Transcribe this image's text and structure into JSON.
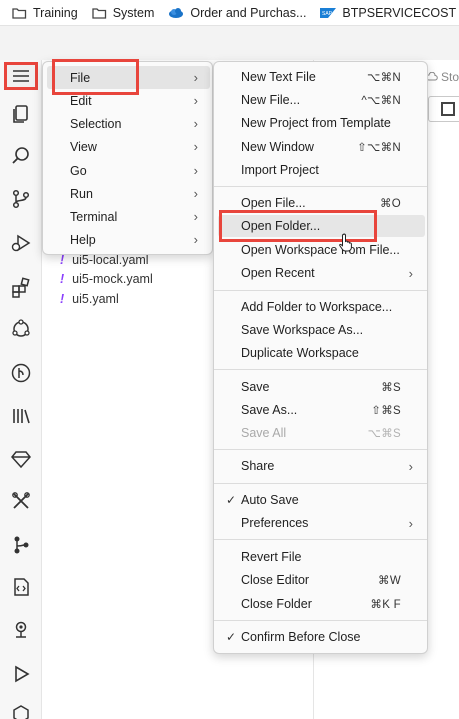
{
  "bookmarks": [
    {
      "label": "Training",
      "icon": "folder-icon"
    },
    {
      "label": "System",
      "icon": "folder-icon"
    },
    {
      "label": "Order and Purchas...",
      "icon": "cloud-icon"
    },
    {
      "label": "BTPSERVICECOST",
      "icon": "sap-icon"
    }
  ],
  "editor": {
    "tab_label": "Sto"
  },
  "explorer": {
    "files": [
      "ui5-local.yaml",
      "ui5-mock.yaml",
      "ui5.yaml"
    ],
    "file_marker": "!"
  },
  "main_menu": {
    "items": [
      {
        "label": "File"
      },
      {
        "label": "Edit"
      },
      {
        "label": "Selection"
      },
      {
        "label": "View"
      },
      {
        "label": "Go"
      },
      {
        "label": "Run"
      },
      {
        "label": "Terminal"
      },
      {
        "label": "Help"
      }
    ],
    "arrow": "›"
  },
  "file_menu": {
    "groups": [
      [
        {
          "label": "New Text File",
          "shortcut": "⌥⌘N"
        },
        {
          "label": "New File...",
          "shortcut": "^⌥⌘N"
        },
        {
          "label": "New Project from Template",
          "shortcut": ""
        },
        {
          "label": "New Window",
          "shortcut": "⇧⌥⌘N"
        },
        {
          "label": "Import Project",
          "shortcut": ""
        }
      ],
      [
        {
          "label": "Open File...",
          "shortcut": "⌘O"
        },
        {
          "label": "Open Folder...",
          "shortcut": ""
        },
        {
          "label": "Open Workspace from File...",
          "shortcut": ""
        },
        {
          "label": "Open Recent",
          "shortcut": "",
          "submenu": true
        }
      ],
      [
        {
          "label": "Add Folder to Workspace...",
          "shortcut": ""
        },
        {
          "label": "Save Workspace As...",
          "shortcut": ""
        },
        {
          "label": "Duplicate Workspace",
          "shortcut": ""
        }
      ],
      [
        {
          "label": "Save",
          "shortcut": "⌘S"
        },
        {
          "label": "Save As...",
          "shortcut": "⇧⌘S"
        },
        {
          "label": "Save All",
          "shortcut": "⌥⌘S",
          "disabled": true
        }
      ],
      [
        {
          "label": "Share",
          "shortcut": "",
          "submenu": true
        }
      ],
      [
        {
          "label": "Auto Save",
          "shortcut": "",
          "checked": true
        },
        {
          "label": "Preferences",
          "shortcut": "",
          "submenu": true
        }
      ],
      [
        {
          "label": "Revert File",
          "shortcut": ""
        },
        {
          "label": "Close Editor",
          "shortcut": "⌘W"
        },
        {
          "label": "Close Folder",
          "shortcut": "⌘K F"
        }
      ],
      [
        {
          "label": "Confirm Before Close",
          "shortcut": "",
          "checked": true
        }
      ]
    ],
    "check_mark": "✓",
    "arrow": "›"
  },
  "colors": {
    "highlight_box": "#e8453c",
    "yaml_marker": "#8a3ffc"
  }
}
